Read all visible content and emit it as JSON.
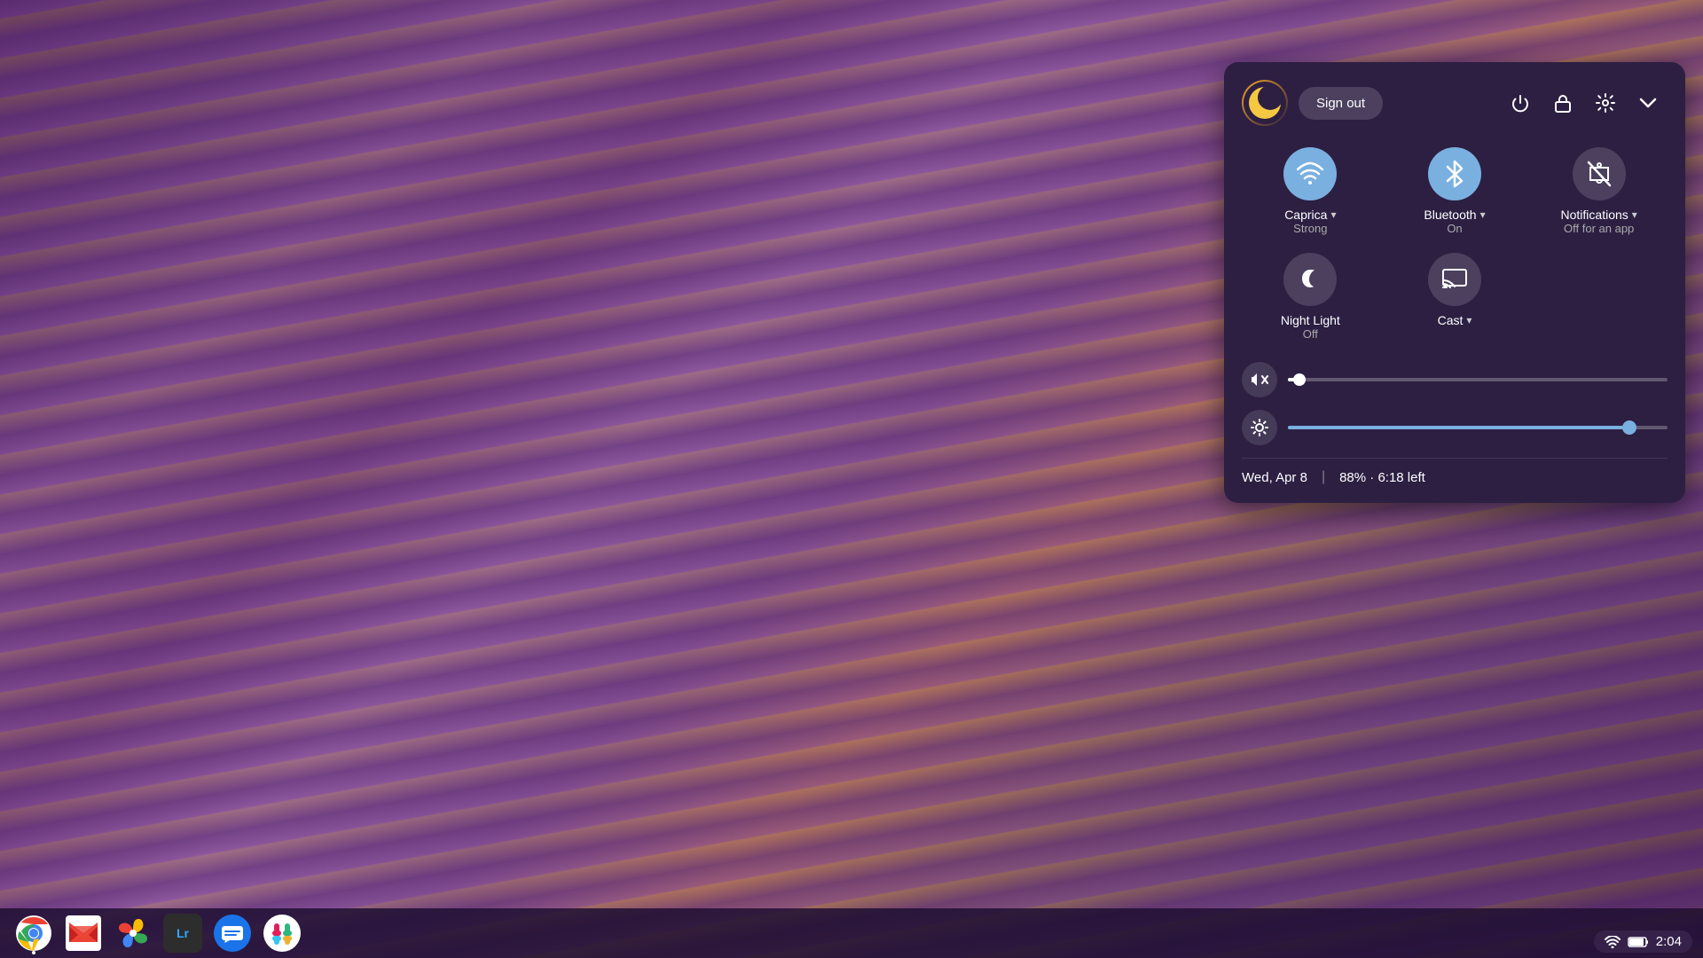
{
  "wallpaper": {
    "description": "Lavender field aerial view"
  },
  "panel": {
    "avatar_emoji": "🌙",
    "sign_out_label": "Sign out",
    "header_icons": [
      {
        "name": "power-icon",
        "symbol": "⏻",
        "label": "Power"
      },
      {
        "name": "lock-icon",
        "symbol": "🔒",
        "label": "Lock"
      },
      {
        "name": "settings-icon",
        "symbol": "⚙",
        "label": "Settings"
      },
      {
        "name": "collapse-icon",
        "symbol": "⌄",
        "label": "Collapse"
      }
    ],
    "tiles": [
      {
        "id": "wifi",
        "icon": "📶",
        "label": "Caprica",
        "sublabel": "Strong",
        "status": "active",
        "has_chevron": true
      },
      {
        "id": "bluetooth",
        "icon": "🔵",
        "label": "Bluetooth",
        "sublabel": "On",
        "status": "active",
        "has_chevron": true
      },
      {
        "id": "notifications",
        "icon": "🔕",
        "label": "Notifications",
        "sublabel": "Off for an app",
        "status": "inactive",
        "has_chevron": true
      }
    ],
    "tiles2": [
      {
        "id": "night-light",
        "icon": "🌙",
        "label": "Night Light",
        "sublabel": "Off",
        "status": "inactive",
        "has_chevron": false
      },
      {
        "id": "cast",
        "icon": "📺",
        "label": "Cast",
        "sublabel": "",
        "status": "inactive",
        "has_chevron": true
      }
    ],
    "sliders": [
      {
        "id": "volume",
        "icon": "🔇",
        "value": 3,
        "fill_color": "#ffffff"
      },
      {
        "id": "brightness",
        "icon": "☀",
        "value": 90,
        "fill_color": "#7ab0e0"
      }
    ],
    "footer": {
      "date": "Wed, Apr 8",
      "battery": "88% · 6:18 left"
    }
  },
  "taskbar": {
    "apps": [
      {
        "id": "chrome",
        "label": "Chrome",
        "emoji": "🌐",
        "color": "#EA4335"
      },
      {
        "id": "gmail",
        "label": "Gmail",
        "emoji": "✉",
        "color": "#EA4335"
      },
      {
        "id": "photos",
        "label": "Google Photos",
        "emoji": "⭐",
        "color": "#FBBC05"
      },
      {
        "id": "lightroom",
        "label": "Lightroom",
        "emoji": "Lr",
        "color": "#31A8FF"
      },
      {
        "id": "messages",
        "label": "Messages",
        "emoji": "💬",
        "color": "#1A73E8"
      },
      {
        "id": "slack",
        "label": "Slack",
        "emoji": "💠",
        "color": "#611f69"
      }
    ]
  },
  "system_tray": {
    "wifi_icon": "▲",
    "battery_icon": "🔋",
    "time": "2:04"
  }
}
